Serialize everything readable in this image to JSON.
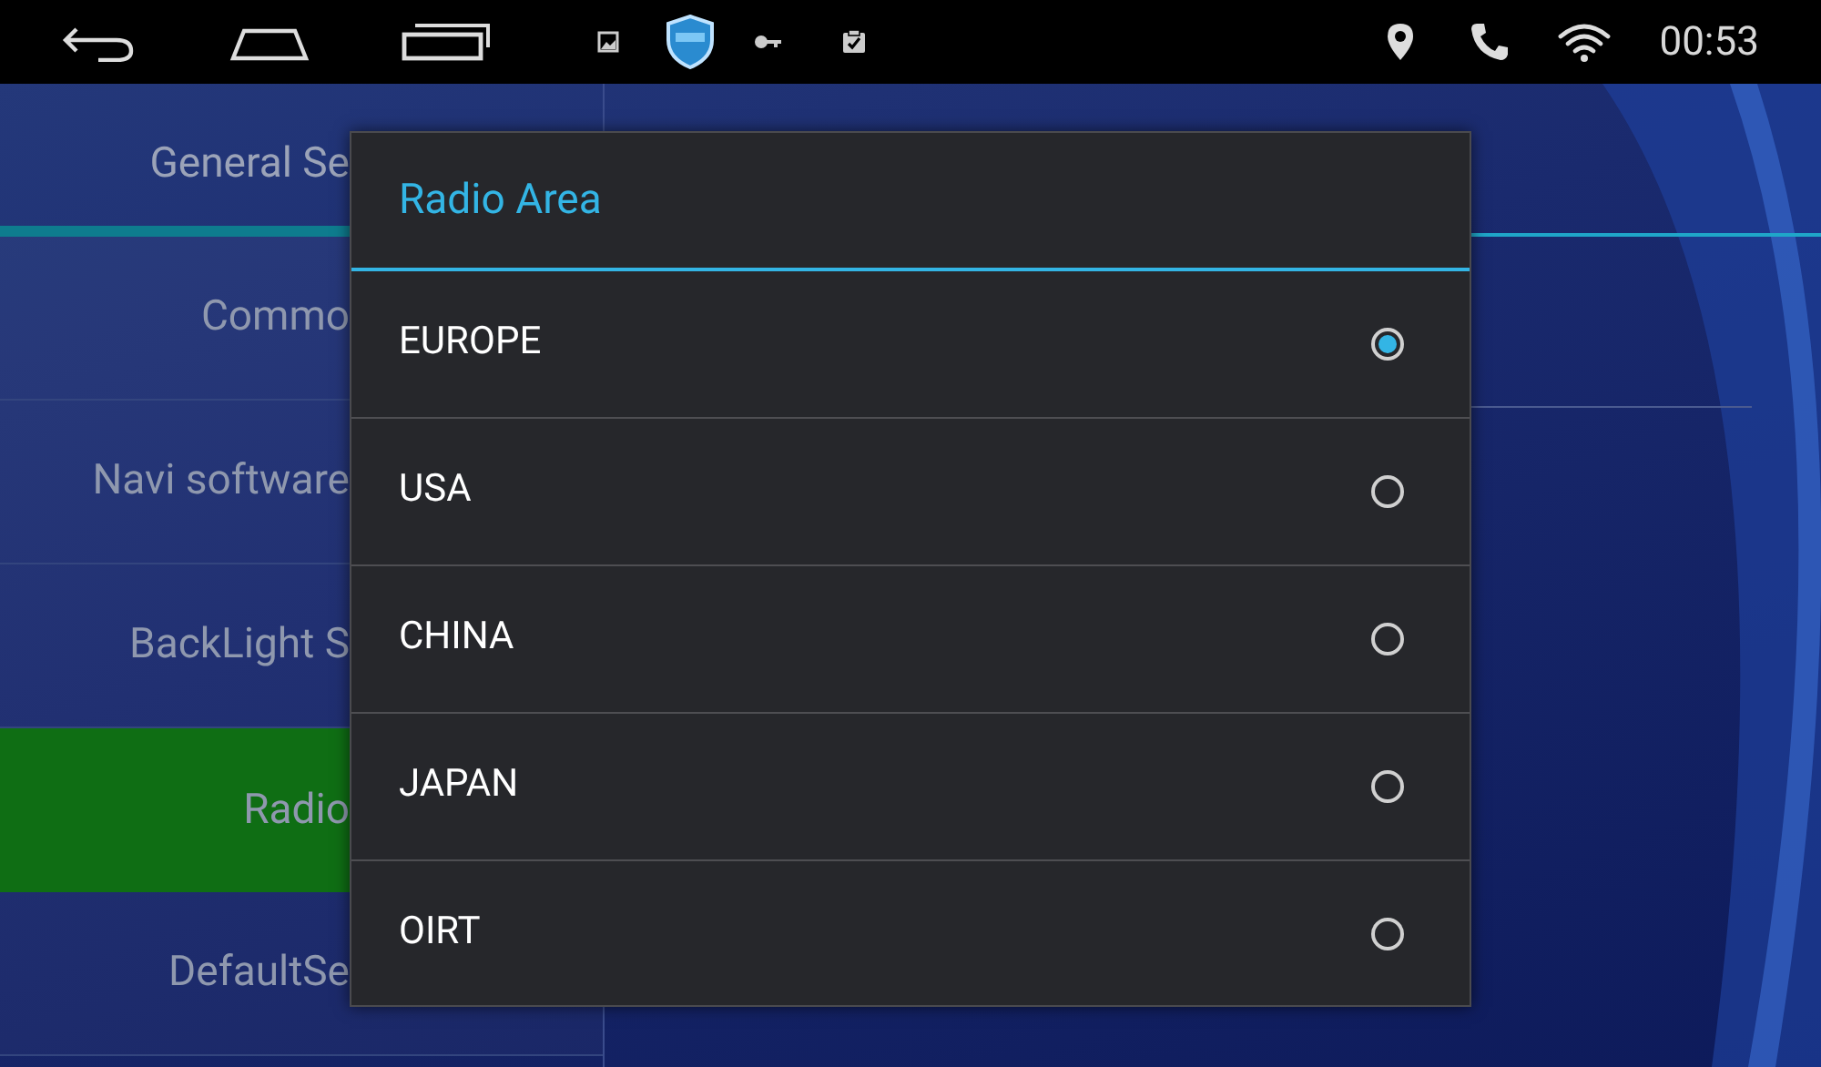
{
  "status_bar": {
    "time": "00:53"
  },
  "tabs": [
    {
      "label": "General Se",
      "selected": true
    }
  ],
  "menu": [
    {
      "label": "Commo",
      "selected": false
    },
    {
      "label": "Navi software",
      "selected": false
    },
    {
      "label": "BackLight S",
      "selected": false
    },
    {
      "label": "Radio",
      "selected": true
    },
    {
      "label": "DefaultSe",
      "selected": false
    }
  ],
  "dialog": {
    "title": "Radio Area",
    "options": [
      {
        "label": "EUROPE",
        "selected": true
      },
      {
        "label": "USA",
        "selected": false
      },
      {
        "label": "CHINA",
        "selected": false
      },
      {
        "label": "JAPAN",
        "selected": false
      },
      {
        "label": "OIRT",
        "selected": false
      }
    ]
  }
}
